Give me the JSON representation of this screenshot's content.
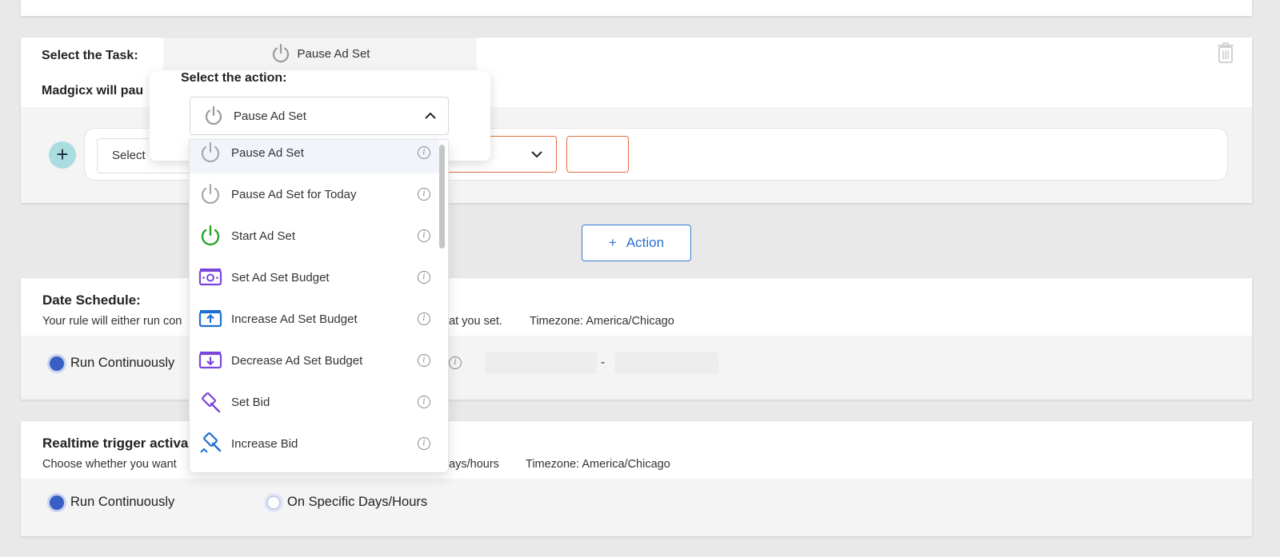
{
  "task": {
    "label": "Select the Task:",
    "selected": "Pause Ad Set",
    "madgicx_text": "Madgicx will pau"
  },
  "condition": {
    "select_placeholder": "Select"
  },
  "popover": {
    "title": "Select the action:",
    "selected": "Pause Ad Set"
  },
  "action_options": [
    {
      "label": "Pause Ad Set",
      "icon": "power-gray-icon"
    },
    {
      "label": "Pause Ad Set for Today",
      "icon": "power-gray-icon"
    },
    {
      "label": "Start Ad Set",
      "icon": "power-green-icon"
    },
    {
      "label": "Set Ad Set Budget",
      "icon": "money-icon"
    },
    {
      "label": "Increase Ad Set Budget",
      "icon": "money-up-icon"
    },
    {
      "label": "Decrease Ad Set Budget",
      "icon": "money-down-icon"
    },
    {
      "label": "Set Bid",
      "icon": "gavel-icon"
    },
    {
      "label": "Increase Bid",
      "icon": "gavel-up-icon"
    }
  ],
  "add_action": {
    "label": "Action"
  },
  "date_schedule": {
    "title": "Date Schedule:",
    "desc_left": "Your rule will either run con",
    "desc_right": "hat you set.",
    "timezone": "Timezone: America/Chicago",
    "run_continuously": "Run Continuously",
    "range_separator": "-"
  },
  "realtime": {
    "title": "Realtime trigger activa",
    "desc_left": "Choose whether you want",
    "desc_right": "days/hours",
    "timezone": "Timezone: America/Chicago",
    "run_continuously": "Run Continuously",
    "specific": "On Specific Days/Hours"
  },
  "colors": {
    "accent_blue": "#2f6fd1",
    "error_orange": "#e46a3c",
    "radio_on": "#3a5fc4",
    "plus_teal": "#a9dde0"
  }
}
